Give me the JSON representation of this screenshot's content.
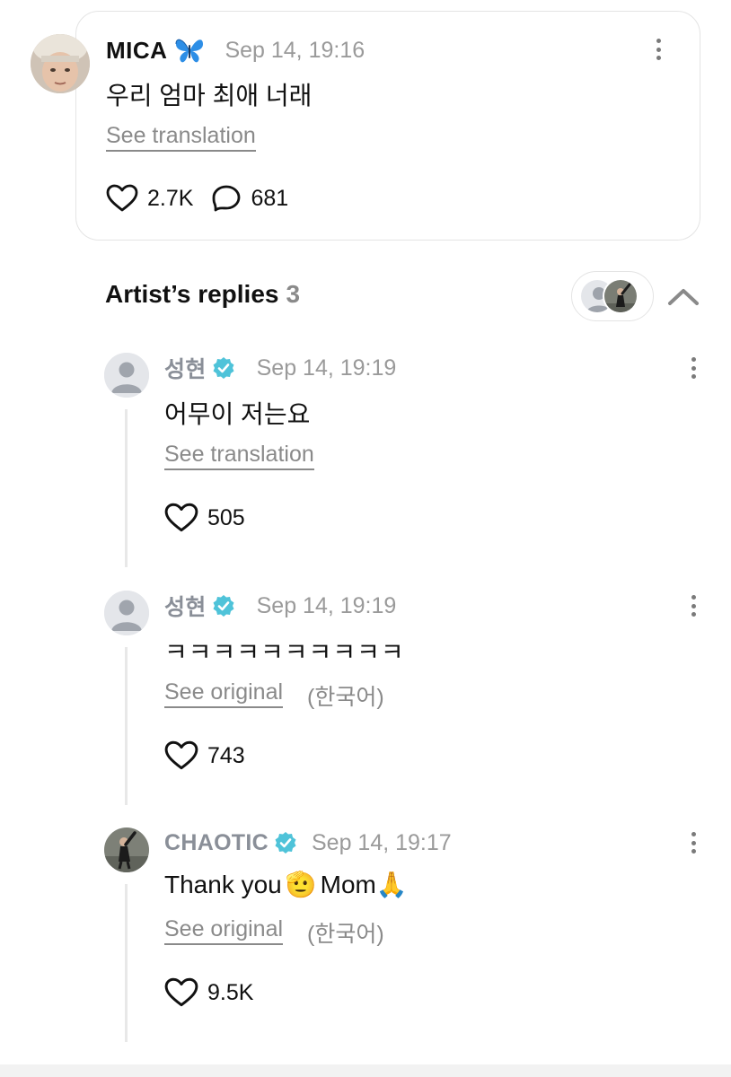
{
  "post": {
    "author": "MICA",
    "author_icon": "butterfly-emoji",
    "timestamp": "Sep 14, 19:16",
    "text": "우리 엄마 최애 너래",
    "translate_label": "See translation",
    "likes": "2.7K",
    "comments": "681"
  },
  "artist_replies": {
    "title": "Artist’s replies",
    "count": "3"
  },
  "replies": [
    {
      "author": "성현",
      "verified": true,
      "timestamp": "Sep 14, 19:19",
      "text": "어무이 저는요",
      "translate_label": "See translation",
      "lang_note": "",
      "likes": "505"
    },
    {
      "author": "성현",
      "verified": true,
      "timestamp": "Sep 14, 19:19",
      "text": "ㅋㅋㅋㅋㅋㅋㅋㅋㅋㅋ",
      "translate_label": "See original",
      "lang_note": "(한국어)",
      "likes": "743"
    },
    {
      "author": "CHAOTIC",
      "verified": true,
      "timestamp": "Sep 14, 19:17",
      "text_before": "Thank you",
      "emoji_1": "🫡",
      "text_middle": "Mom",
      "emoji_2": "🙏",
      "translate_label": "See original",
      "lang_note": "(한국어)",
      "likes": "9.5K"
    }
  ],
  "colors": {
    "verified_badge": "#4fc3d9",
    "muted_text": "#9a9a9a",
    "card_border": "#e4e4e4"
  }
}
